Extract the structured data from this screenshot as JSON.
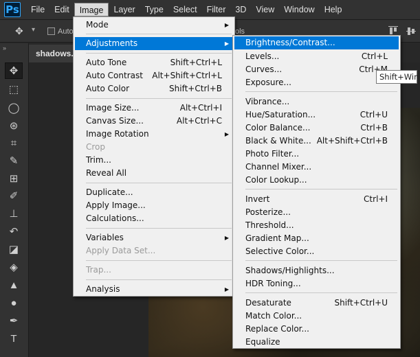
{
  "app": {
    "logo": "Ps"
  },
  "menubar": {
    "items": [
      "File",
      "Edit",
      "Image",
      "Layer",
      "Type",
      "Select",
      "Filter",
      "3D",
      "View",
      "Window",
      "Help"
    ],
    "active": "Image"
  },
  "options": {
    "auto_label": "Auto",
    "partial_label": "ols"
  },
  "document": {
    "tab_label": "shadows.p"
  },
  "toolbar": {
    "collapse_label": "»"
  },
  "image_menu": {
    "mode": "Mode",
    "adjustments": "Adjustments",
    "auto_tone": "Auto Tone",
    "auto_tone_sc": "Shift+Ctrl+L",
    "auto_contrast": "Auto Contrast",
    "auto_contrast_sc": "Alt+Shift+Ctrl+L",
    "auto_color": "Auto Color",
    "auto_color_sc": "Shift+Ctrl+B",
    "image_size": "Image Size...",
    "image_size_sc": "Alt+Ctrl+I",
    "canvas_size": "Canvas Size...",
    "canvas_size_sc": "Alt+Ctrl+C",
    "image_rotation": "Image Rotation",
    "crop": "Crop",
    "trim": "Trim...",
    "reveal_all": "Reveal All",
    "duplicate": "Duplicate...",
    "apply_image": "Apply Image...",
    "calculations": "Calculations...",
    "variables": "Variables",
    "apply_data_set": "Apply Data Set...",
    "trap": "Trap...",
    "analysis": "Analysis"
  },
  "adjustments_menu": {
    "brightness_contrast": "Brightness/Contrast...",
    "levels": "Levels...",
    "levels_sc": "Ctrl+L",
    "curves": "Curves...",
    "curves_sc": "Ctrl+M",
    "exposure": "Exposure...",
    "vibrance": "Vibrance...",
    "hue_saturation": "Hue/Saturation...",
    "hue_saturation_sc": "Ctrl+U",
    "color_balance": "Color Balance...",
    "color_balance_sc": "Ctrl+B",
    "black_white": "Black & White...",
    "black_white_sc": "Alt+Shift+Ctrl+B",
    "photo_filter": "Photo Filter...",
    "channel_mixer": "Channel Mixer...",
    "color_lookup": "Color Lookup...",
    "invert": "Invert",
    "invert_sc": "Ctrl+I",
    "posterize": "Posterize...",
    "threshold": "Threshold...",
    "gradient_map": "Gradient Map...",
    "selective_color": "Selective Color...",
    "shadows_highlights": "Shadows/Highlights...",
    "hdr_toning": "HDR Toning...",
    "desaturate": "Desaturate",
    "desaturate_sc": "Shift+Ctrl+U",
    "match_color": "Match Color...",
    "replace_color": "Replace Color...",
    "equalize": "Equalize"
  },
  "tooltip": {
    "text": "Shift+Win"
  },
  "colors": {
    "highlight": "#0078d7",
    "ps_blue": "#31a8ff",
    "menu_bg": "#f0f0f0"
  }
}
